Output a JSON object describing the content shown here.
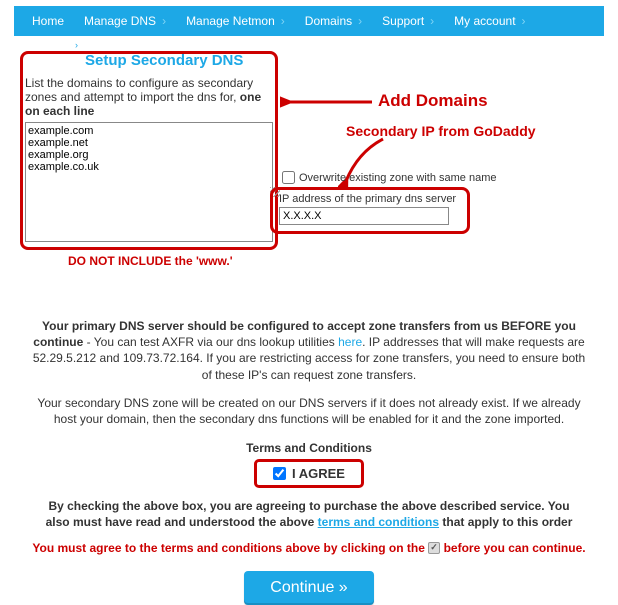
{
  "nav": {
    "items": [
      {
        "label": "Home",
        "chev": ""
      },
      {
        "label": "Manage DNS",
        "chev": "›"
      },
      {
        "label": "Manage Netmon",
        "chev": "›"
      },
      {
        "label": "Domains",
        "chev": "›"
      },
      {
        "label": "Support",
        "chev": "›"
      },
      {
        "label": "My account",
        "chev": "›"
      }
    ]
  },
  "breadcrumb_chev": "›",
  "page_title": "Setup Secondary DNS",
  "instruction_pre": "List the domains to configure as secondary zones and attempt to import the dns for, ",
  "instruction_bold": "one on each line",
  "domains_value": "example.com\nexample.net\nexample.org\nexample.co.uk",
  "annotations": {
    "add_domains": "Add Domains",
    "secondary_ip": "Secondary IP from GoDaddy",
    "no_www": "DO NOT INCLUDE the 'www.'"
  },
  "overwrite_label": "Overwrite existing zone with same name",
  "ip_label": "IP address of the primary dns server",
  "ip_value": "X.X.X.X",
  "info1_bold": "Your primary DNS server should be configured to accept zone transfers from us BEFORE you continue",
  "info1_rest1": " - You can test AXFR via our dns lookup utilities ",
  "info1_here": "here",
  "info1_rest2": ". IP addresses that will make requests are 52.29.5.212 and 109.73.72.164. If you are restricting access for zone transfers, you need to ensure both of these IP's can request zone transfers.",
  "info2": "Your secondary DNS zone will be created on our DNS servers if it does not already exist. If we already host your domain, then the secondary dns functions will be enabled for it and the zone imported.",
  "tc_title": "Terms and Conditions",
  "agree_label": "I AGREE",
  "disclaimer_pre": "By checking the above box, you are agreeing to purchase the above described service. You also must have read and understood the above ",
  "disclaimer_link": "terms and conditions",
  "disclaimer_post": " that apply to this order",
  "warn_pre": "You must agree to the terms and conditions above by clicking on the ",
  "warn_post": " before you can continue.",
  "continue_label": "Continue »"
}
